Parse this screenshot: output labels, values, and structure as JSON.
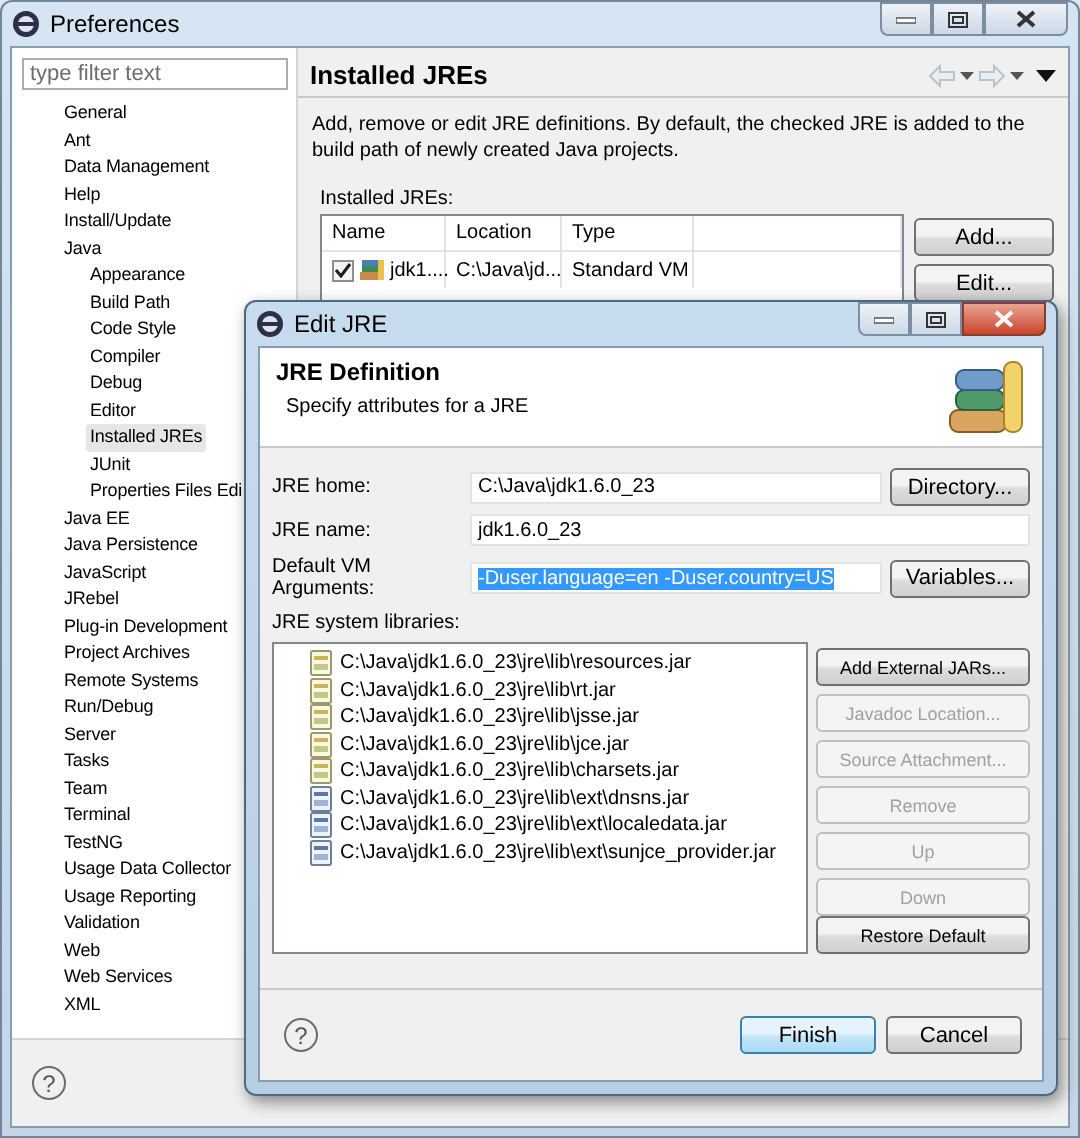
{
  "window": {
    "title": "Preferences"
  },
  "filter": {
    "placeholder": "type filter text"
  },
  "tree": [
    {
      "label": "General",
      "selected": false
    },
    {
      "label": "Ant",
      "selected": false
    },
    {
      "label": "Data Management",
      "selected": false
    },
    {
      "label": "Help",
      "selected": false
    },
    {
      "label": "Install/Update",
      "selected": false
    },
    {
      "label": "Java",
      "selected": false,
      "children": [
        {
          "label": "Appearance",
          "selected": false
        },
        {
          "label": "Build Path",
          "selected": false
        },
        {
          "label": "Code Style",
          "selected": false
        },
        {
          "label": "Compiler",
          "selected": false
        },
        {
          "label": "Debug",
          "selected": false
        },
        {
          "label": "Editor",
          "selected": false
        },
        {
          "label": "Installed JREs",
          "selected": true
        },
        {
          "label": "JUnit",
          "selected": false
        },
        {
          "label": "Properties Files Edi",
          "selected": false
        }
      ]
    },
    {
      "label": "Java EE",
      "selected": false
    },
    {
      "label": "Java Persistence",
      "selected": false
    },
    {
      "label": "JavaScript",
      "selected": false
    },
    {
      "label": "JRebel",
      "selected": false
    },
    {
      "label": "Plug-in Development",
      "selected": false
    },
    {
      "label": "Project Archives",
      "selected": false
    },
    {
      "label": "Remote Systems",
      "selected": false
    },
    {
      "label": "Run/Debug",
      "selected": false
    },
    {
      "label": "Server",
      "selected": false
    },
    {
      "label": "Tasks",
      "selected": false
    },
    {
      "label": "Team",
      "selected": false
    },
    {
      "label": "Terminal",
      "selected": false
    },
    {
      "label": "TestNG",
      "selected": false
    },
    {
      "label": "Usage Data Collector",
      "selected": false
    },
    {
      "label": "Usage Reporting",
      "selected": false
    },
    {
      "label": "Validation",
      "selected": false
    },
    {
      "label": "Web",
      "selected": false
    },
    {
      "label": "Web Services",
      "selected": false
    },
    {
      "label": "XML",
      "selected": false
    }
  ],
  "help_icon": "?",
  "page": {
    "title": "Installed JREs",
    "description": "Add, remove or edit JRE definitions. By default, the checked JRE is added to the build path of newly created Java projects.",
    "table_label": "Installed JREs:",
    "table": {
      "columns": [
        "Name",
        "Location",
        "Type"
      ],
      "rows": [
        {
          "checked": true,
          "cells": [
            "jdk1....",
            "C:\\Java\\jd...",
            "Standard VM"
          ]
        }
      ]
    },
    "buttons": [
      "Add...",
      "Edit..."
    ]
  },
  "dialog": {
    "title": "Edit JRE",
    "heading": "JRE Definition",
    "subheading": "Specify attributes for a JRE",
    "fields": [
      {
        "label": "JRE home:",
        "value": "C:\\Java\\jdk1.6.0_23",
        "text_selected": false,
        "button": "Directory..."
      },
      {
        "label": "JRE name:",
        "value": "jdk1.6.0_23",
        "text_selected": false
      },
      {
        "label": "Default VM Arguments:",
        "value": "-Duser.language=en -Duser.country=US",
        "text_selected": true,
        "button": "Variables..."
      }
    ],
    "libraries_label": "JRE system libraries:",
    "libraries": [
      {
        "path": "C:\\Java\\jdk1.6.0_23\\jre\\lib\\resources.jar",
        "kind": "lib"
      },
      {
        "path": "C:\\Java\\jdk1.6.0_23\\jre\\lib\\rt.jar",
        "kind": "lib"
      },
      {
        "path": "C:\\Java\\jdk1.6.0_23\\jre\\lib\\jsse.jar",
        "kind": "lib"
      },
      {
        "path": "C:\\Java\\jdk1.6.0_23\\jre\\lib\\jce.jar",
        "kind": "lib"
      },
      {
        "path": "C:\\Java\\jdk1.6.0_23\\jre\\lib\\charsets.jar",
        "kind": "lib"
      },
      {
        "path": "C:\\Java\\jdk1.6.0_23\\jre\\lib\\ext\\dnsns.jar",
        "kind": "ext"
      },
      {
        "path": "C:\\Java\\jdk1.6.0_23\\jre\\lib\\ext\\localedata.jar",
        "kind": "ext"
      },
      {
        "path": "C:\\Java\\jdk1.6.0_23\\jre\\lib\\ext\\sunjce_provider.jar",
        "kind": "ext"
      }
    ],
    "side_buttons": [
      {
        "label": "Add External JARs...",
        "disabled": false
      },
      {
        "label": "Javadoc Location...",
        "disabled": true
      },
      {
        "label": "Source Attachment...",
        "disabled": true
      },
      {
        "label": "Remove",
        "disabled": true
      },
      {
        "label": "Up",
        "disabled": true
      },
      {
        "label": "Down",
        "disabled": true
      },
      {
        "label": "Restore Default",
        "disabled": false
      }
    ],
    "footer_buttons": [
      {
        "label": "Finish",
        "default": true
      },
      {
        "label": "Cancel",
        "default": false
      }
    ]
  }
}
